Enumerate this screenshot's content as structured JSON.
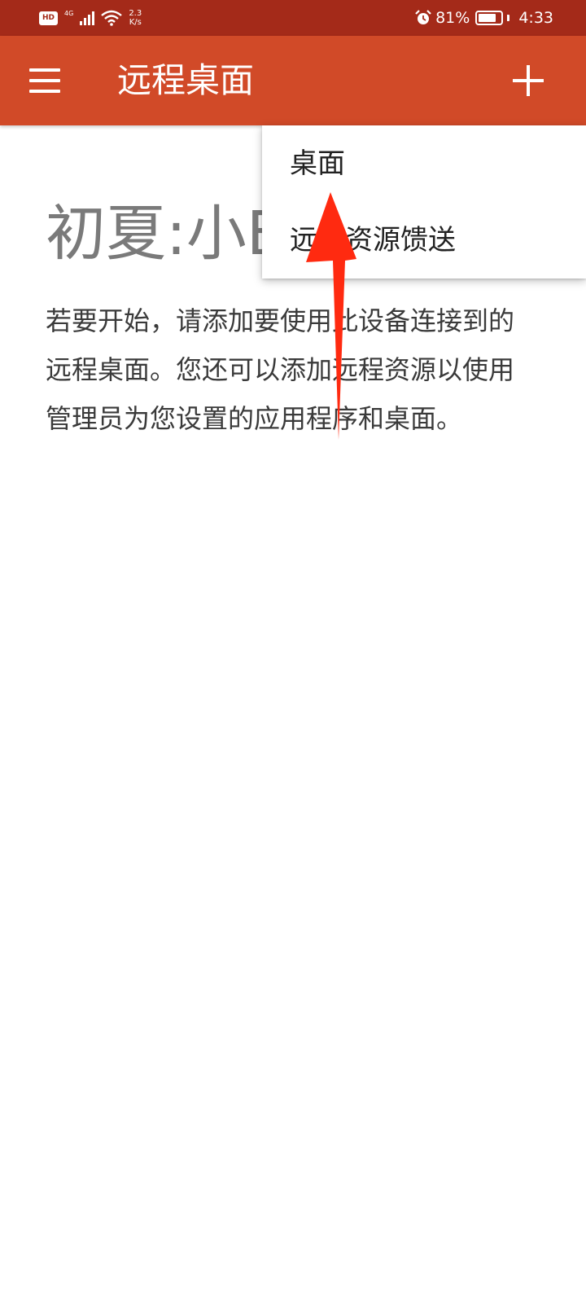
{
  "status_bar": {
    "hd_badge": "HD",
    "network_type": "4G",
    "net_speed_value": "2.3",
    "net_speed_unit": "K/s",
    "battery_percent": "81%",
    "battery_level": 0.81,
    "time": "4:33",
    "icons": [
      "hd-icon",
      "signal-icon",
      "wifi-icon",
      "alarm-icon",
      "battery-icon"
    ]
  },
  "app_bar": {
    "menu_icon": "hamburger-menu-icon",
    "title": "远程桌面",
    "add_icon": "plus-icon",
    "background_color": "#d14a28"
  },
  "main": {
    "welcome_title": "初夏:小E",
    "description": "若要开始，请添加要使用此设备连接到的远程桌面。您还可以添加远程资源以使用管理员为您设置的应用程序和桌面。"
  },
  "dropdown_menu": {
    "items": [
      {
        "label": "桌面"
      },
      {
        "label": "远程资源馈送"
      }
    ]
  },
  "annotation": {
    "arrow_color": "#ff2a10"
  }
}
